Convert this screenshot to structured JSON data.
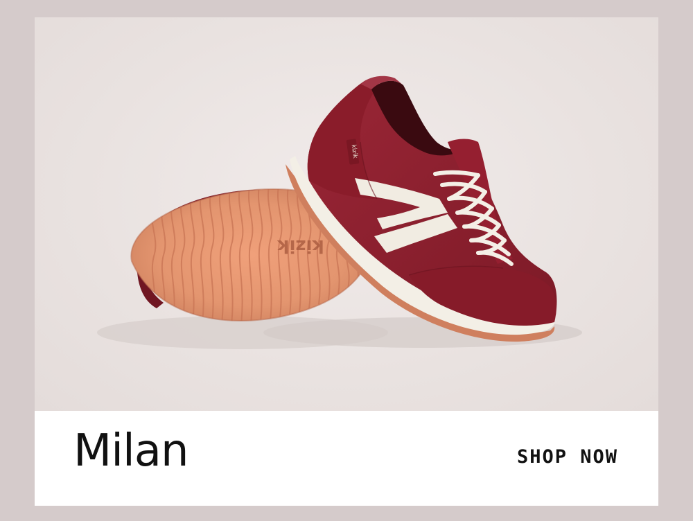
{
  "product": {
    "name": "Milan",
    "brand_mark": "kizik",
    "image_alt": "Burgundy Milan sneaker with white stripe and gum sole"
  },
  "cta": {
    "label": "SHOP NOW"
  },
  "colors": {
    "page_background": "#d5cbcb",
    "hero_background": "#ebe4e2",
    "shoe_burgundy": "#8c1f2c",
    "sole_gum": "#d68868",
    "stripe_cream": "#f1ece2",
    "text": "#111111"
  }
}
